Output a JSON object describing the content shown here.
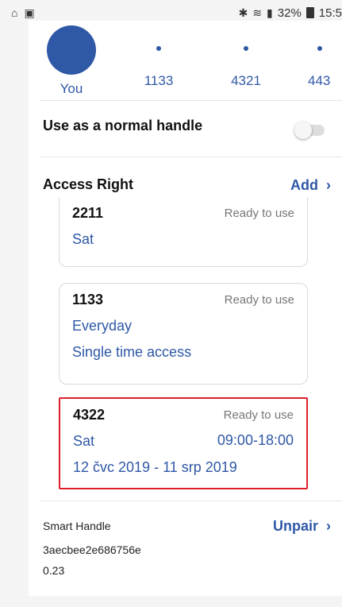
{
  "status_bar": {
    "left_icons": [
      "notification-icon",
      "image-icon"
    ],
    "signal_text": "32%",
    "time": "15:5"
  },
  "users": [
    {
      "name": "You",
      "selected": true
    },
    {
      "name": "1133",
      "selected": false
    },
    {
      "name": "4321",
      "selected": false
    },
    {
      "name": "443",
      "selected": false
    }
  ],
  "normal_handle": {
    "label": "Use as a normal handle",
    "enabled": false
  },
  "access_right": {
    "title": "Access Right",
    "add_label": "Add",
    "cards": [
      {
        "code": "2211",
        "status": "Ready to use",
        "days": "Sat"
      },
      {
        "code": "1133",
        "status": "Ready to use",
        "days": "Everyday",
        "mode": "Single time access"
      },
      {
        "code": "4322",
        "status": "Ready to use",
        "days": "Sat",
        "time": "09:00-18:00",
        "dates": "12 čvc 2019 - 11 srp 2019"
      }
    ]
  },
  "smart_handle": {
    "title": "Smart Handle",
    "id": "3aecbee2e686756e",
    "version": "0.23",
    "unpair_label": "Unpair"
  },
  "colors": {
    "accent": "#2f58a6",
    "highlight": "#e01e2b"
  }
}
